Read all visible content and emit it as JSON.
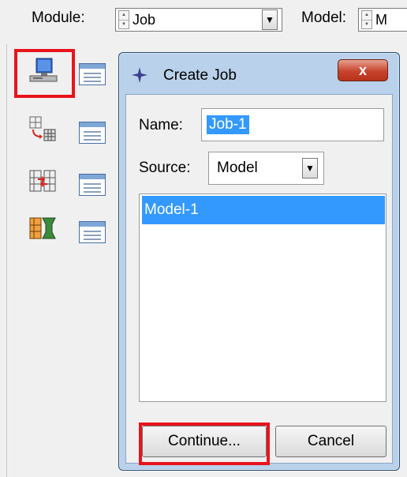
{
  "topbar": {
    "module_label": "Module:",
    "module_value": "Job",
    "model_label": "Model:",
    "model_value": "M"
  },
  "toolbox": {
    "tools": [
      {
        "icon": "create-job-icon",
        "manager_icon": "job-manager-icon",
        "highlighted": true
      },
      {
        "icon": "create-adaptivity-process-icon",
        "manager_icon": "adaptivity-manager-icon"
      },
      {
        "icon": "create-coexecution-icon",
        "manager_icon": "coexecution-manager-icon"
      },
      {
        "icon": "create-optimization-process-icon",
        "manager_icon": "optimization-manager-icon"
      }
    ]
  },
  "dialog": {
    "title": "Create Job",
    "close_glyph": "x",
    "name_label": "Name:",
    "name_value": "Job-1",
    "source_label": "Source:",
    "source_value": "Model",
    "list_items": [
      "Model-1"
    ],
    "selected_index": 0,
    "continue_label": "Continue...",
    "cancel_label": "Cancel"
  },
  "colors": {
    "highlight": "#e8141c",
    "selection": "#3399ff",
    "dialog_frame": "#b9d1ea",
    "close_button": "#c7442d"
  }
}
